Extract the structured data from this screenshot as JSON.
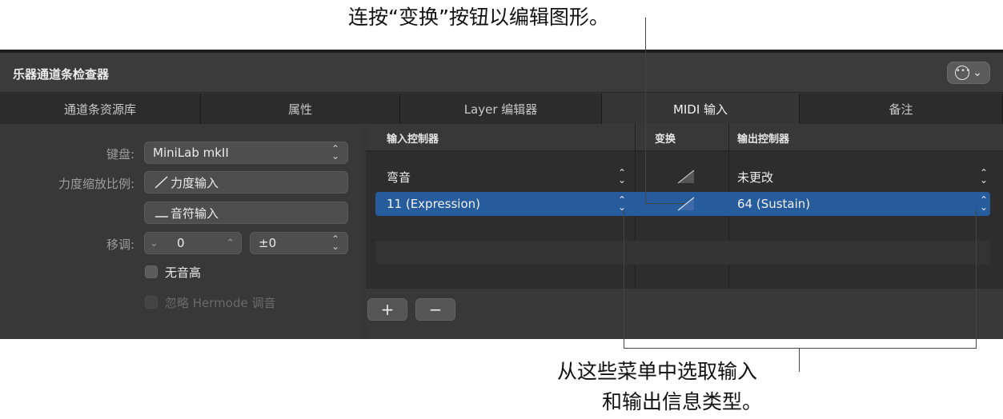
{
  "callouts": {
    "top": "连按“变换”按钮以编辑图形。",
    "bottom_line1": "从这些菜单中选取输入",
    "bottom_line2": "和输出信息类型。"
  },
  "window": {
    "title": "乐器通道条检查器",
    "more_icon": "ellipsis-circle-icon"
  },
  "tabs": [
    {
      "label": "通道条资源库",
      "active": false
    },
    {
      "label": "属性",
      "active": false
    },
    {
      "label": "Layer 编辑器",
      "active": false
    },
    {
      "label": "MIDI 输入",
      "active": true
    },
    {
      "label": "备注",
      "active": false
    }
  ],
  "left": {
    "keyboard_label": "键盘:",
    "keyboard_value": "MiniLab mkII",
    "velocity_label": "力度缩放比例:",
    "velocity_input": "力度输入",
    "note_input": "音符输入",
    "transpose_label": "移调:",
    "transpose_value": "0",
    "transpose_offset": "±0",
    "no_pitch": "无音高",
    "ignore_hermode": "忽略 Hermode 调音"
  },
  "midi_table": {
    "headers": {
      "input": "输入控制器",
      "transform": "变换",
      "output": "输出控制器"
    },
    "rows": [
      {
        "input": "弯音",
        "output": "未更改",
        "selected": false
      },
      {
        "input": "11 (Expression)",
        "output": "64 (Sustain)",
        "selected": true
      }
    ],
    "add_label": "+",
    "remove_label": "−"
  },
  "colors": {
    "panel_bg": "#363636",
    "selection": "#275c9c",
    "leader_line": "#444444"
  }
}
